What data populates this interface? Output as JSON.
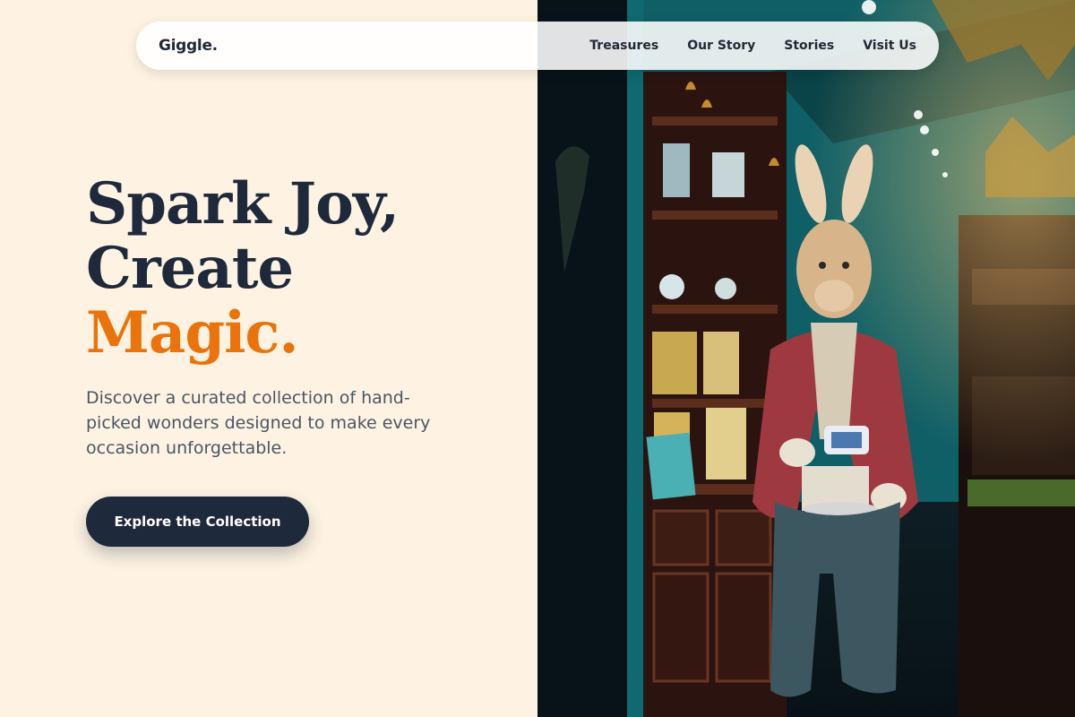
{
  "brand": {
    "logo": "Giggle."
  },
  "nav": {
    "items": [
      {
        "label": "Treasures"
      },
      {
        "label": "Our Story"
      },
      {
        "label": "Stories"
      },
      {
        "label": "Visit Us"
      }
    ]
  },
  "hero": {
    "headline_line1": "Spark Joy,",
    "headline_line2": "Create",
    "headline_line3": "Magic.",
    "description": "Discover a curated collection of hand-picked wonders designed to make every occasion unforgettable.",
    "cta_label": "Explore the Collection"
  },
  "colors": {
    "background": "#fef3e2",
    "heading": "#1e293b",
    "accent": "#ea730b",
    "body_text": "#4b5563",
    "button": "#1e293b",
    "teal": "#0d6e73"
  },
  "image": {
    "alt": "Shop interior with a rabbit statue in a red coat holding a teacup"
  }
}
